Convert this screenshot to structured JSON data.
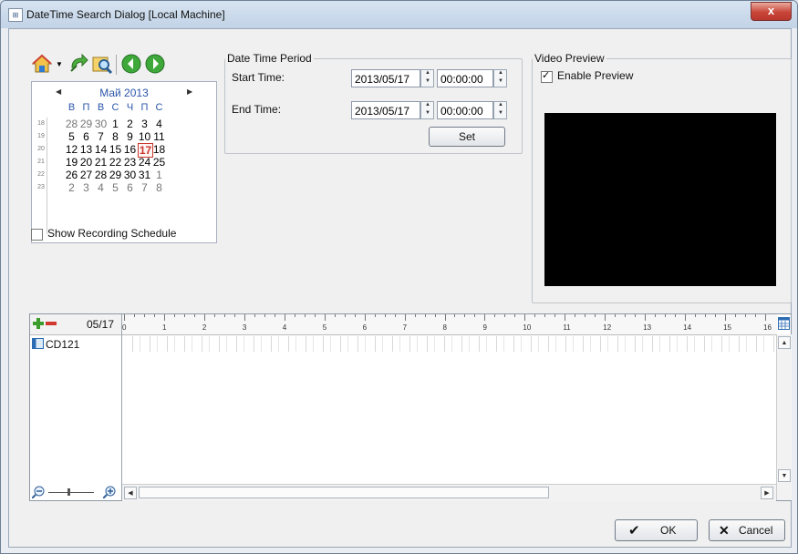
{
  "window": {
    "title": "DateTime Search Dialog  [Local Machine]",
    "close_label": "x"
  },
  "calendar": {
    "month_label": "Май 2013",
    "weekdays": [
      "В",
      "П",
      "В",
      "С",
      "Ч",
      "П",
      "С"
    ],
    "weeks": [
      {
        "wk": "18",
        "days": [
          "28",
          "29",
          "30",
          "1",
          "2",
          "3",
          "4"
        ]
      },
      {
        "wk": "19",
        "days": [
          "5",
          "6",
          "7",
          "8",
          "9",
          "10",
          "11"
        ]
      },
      {
        "wk": "20",
        "days": [
          "12",
          "13",
          "14",
          "15",
          "16",
          "17",
          "18"
        ]
      },
      {
        "wk": "21",
        "days": [
          "19",
          "20",
          "21",
          "22",
          "23",
          "24",
          "25"
        ]
      },
      {
        "wk": "22",
        "days": [
          "26",
          "27",
          "28",
          "29",
          "30",
          "31",
          "1"
        ]
      },
      {
        "wk": "23",
        "days": [
          "2",
          "3",
          "4",
          "5",
          "6",
          "7",
          "8"
        ]
      }
    ],
    "selected_day": "17"
  },
  "schedule": {
    "label": "Show Recording Schedule",
    "checked": false
  },
  "period": {
    "legend": "Date Time Period",
    "start_label": "Start Time:",
    "start_date": "2013/05/17",
    "start_time": "00:00:00",
    "end_label": "End Time:",
    "end_date": "2013/05/17",
    "end_time": "00:00:00",
    "set_label": "Set"
  },
  "preview": {
    "legend": "Video Preview",
    "enable_label": "Enable Preview",
    "enabled": true
  },
  "timeline": {
    "date_label": "05/17",
    "camera_label": "CD121",
    "hours": [
      "0",
      "1",
      "2",
      "3",
      "4",
      "5",
      "6",
      "7",
      "8",
      "9",
      "10",
      "11",
      "12",
      "13",
      "14",
      "15",
      "16"
    ]
  },
  "buttons": {
    "ok_label": "OK",
    "cancel_label": "Cancel"
  }
}
